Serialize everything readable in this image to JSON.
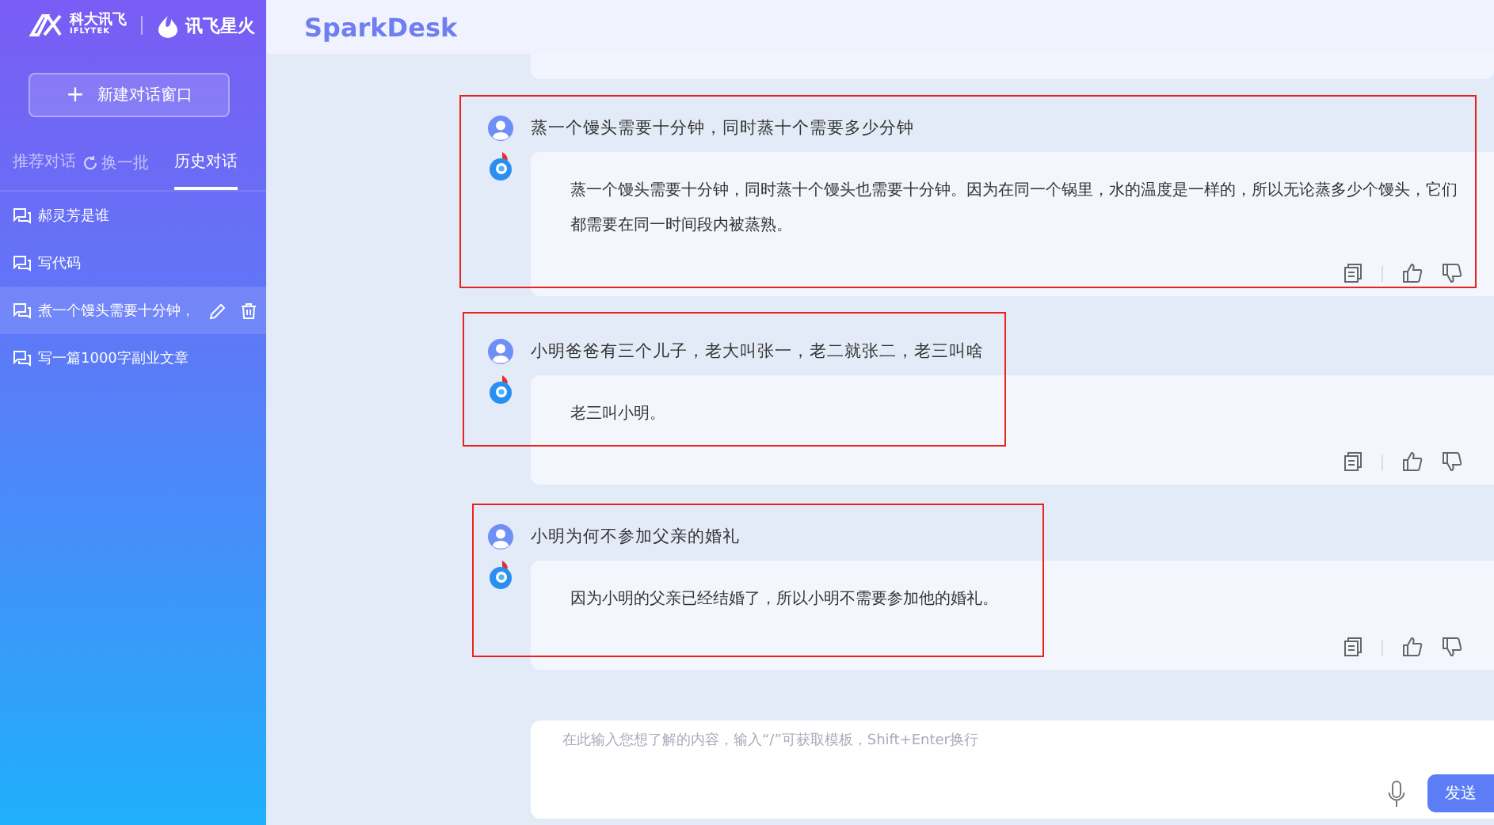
{
  "sidebar": {
    "brand": {
      "company_cn": "科大讯飞",
      "company_en": "IFLYTEK",
      "product": "讯飞星火"
    },
    "new_chat_button": {
      "icon": "+",
      "label": "新建对话窗口"
    },
    "tabs": [
      {
        "label": "推荐对话",
        "selected": false
      },
      {
        "label": "历史对话",
        "selected": true
      }
    ],
    "refresh_link": "换一批",
    "history": [
      {
        "title": "郝灵芳是谁",
        "selected": false
      },
      {
        "title": "写代码",
        "selected": false
      },
      {
        "title": "煮一个馒头需要十分钟，",
        "selected": true
      },
      {
        "title": "写一篇1000字副业文章",
        "selected": false
      }
    ]
  },
  "header": {
    "title": "SparkDesk"
  },
  "messages": [
    {
      "question": "蒸一个馒头需要十分钟，同时蒸十个需要多少分钟",
      "answer": "蒸一个馒头需要十分钟，同时蒸十个馒头也需要十分钟。因为在同一个锅里，水的温度是一样的，所以无论蒸多少个馒头，它们都需要在同一时间段内被蒸熟。",
      "highlighted": true
    },
    {
      "question": "小明爸爸有三个儿子，老大叫张一，老二就张二，老三叫啥",
      "answer": "老三叫小明。",
      "highlighted": true
    },
    {
      "question": "小明为何不参加父亲的婚礼",
      "answer": "因为小明的父亲已经结婚了，所以小明不需要参加他的婚礼。",
      "highlighted": true
    }
  ],
  "input": {
    "placeholder": "在此输入您想了解的内容，输入“/”可获取模板，Shift+Enter换行",
    "send_button": "发送"
  }
}
